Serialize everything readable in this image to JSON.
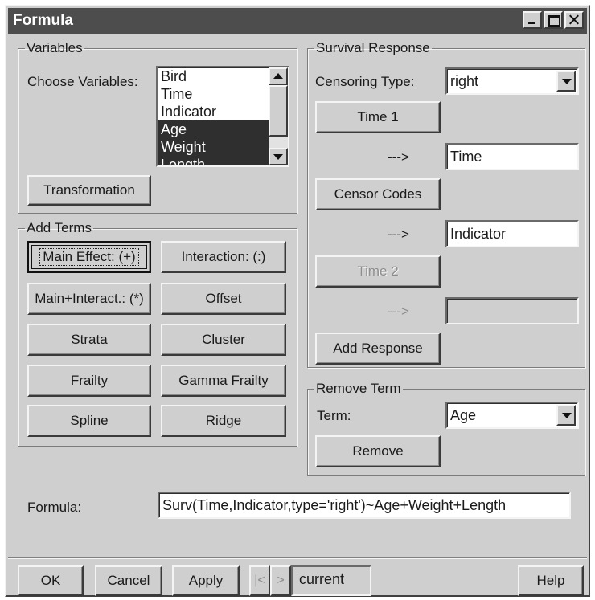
{
  "window": {
    "title": "Formula"
  },
  "variables": {
    "legend": "Variables",
    "choose_label": "Choose Variables:",
    "items": [
      {
        "label": "Bird",
        "selected": false
      },
      {
        "label": "Time",
        "selected": false
      },
      {
        "label": "Indicator",
        "selected": false
      },
      {
        "label": "Age",
        "selected": true
      },
      {
        "label": "Weight",
        "selected": true
      },
      {
        "label": "Length",
        "selected": true
      }
    ],
    "transformation_label": "Transformation"
  },
  "add_terms": {
    "legend": "Add Terms",
    "buttons": [
      "Main Effect: (+)",
      "Interaction: (:)",
      "Main+Interact.: (*)",
      "Offset",
      "Strata",
      "Cluster",
      "Frailty",
      "Gamma Frailty",
      "Spline",
      "Ridge"
    ]
  },
  "survival": {
    "legend": "Survival Response",
    "censoring_label": "Censoring Type:",
    "censoring_value": "right",
    "time1_label": "Time 1",
    "arrow": "--->",
    "time1_value": "Time",
    "censor_codes_label": "Censor Codes",
    "censor_value": "Indicator",
    "time2_label": "Time 2",
    "time2_value": "",
    "add_response_label": "Add Response"
  },
  "remove_term": {
    "legend": "Remove Term",
    "term_label": "Term:",
    "term_value": "Age",
    "remove_label": "Remove"
  },
  "formula": {
    "label": "Formula:",
    "value": "Surv(Time,Indicator,type='right')~Age+Weight+Length"
  },
  "footer": {
    "ok": "OK",
    "cancel": "Cancel",
    "apply": "Apply",
    "prev": "|<",
    "next": ">",
    "page": "current",
    "help": "Help"
  },
  "colors": {
    "face": "#cfcfcf",
    "titlebar": "#4d4d4d",
    "selection": "#2f2f2f"
  }
}
